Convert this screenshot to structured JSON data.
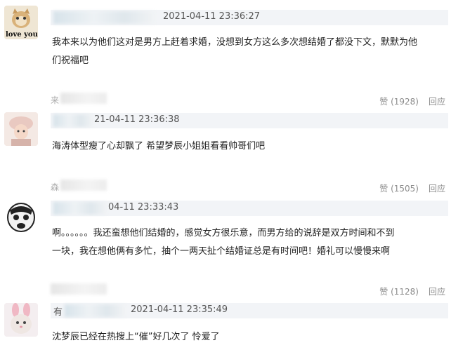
{
  "comments": [
    {
      "avatar_text": "love you",
      "timestamp": "2021-04-11 23:36:27",
      "text_line1": "我本来以为他们这对是男方上赶着求婚，没想到女方这么多次想结婚了都没下文，默默为他",
      "text_line2": "们祝福吧",
      "likes": "赞 (1928)",
      "reply": "回应"
    },
    {
      "timestamp": "21-04-11 23:36:38",
      "text_line1": "海涛体型瘦了心却飘了 希望梦辰小姐姐看看帅哥们吧",
      "likes": "赞 (1505)",
      "reply": "回应"
    },
    {
      "timestamp": "04-11 23:33:43",
      "text_line1": "啊。。。。。。我还蛮想他们结婚的，感觉女方很乐意，而男方给的说辞是双方时间和不到",
      "text_line2": "一块，我在想他俩有多忙，抽个一两天扯个结婚证总是有时间吧！婚礼可以慢慢来啊",
      "likes": "赞 (1128)",
      "reply": "回应"
    },
    {
      "name_prefix": "有",
      "timestamp": "2021-04-11 23:35:49",
      "text_line1": "沈梦辰已经在热搜上“催”好几次了 怜爱了"
    }
  ],
  "partial_names": {
    "c2_prefix": "来",
    "c3_prefix": "森"
  }
}
